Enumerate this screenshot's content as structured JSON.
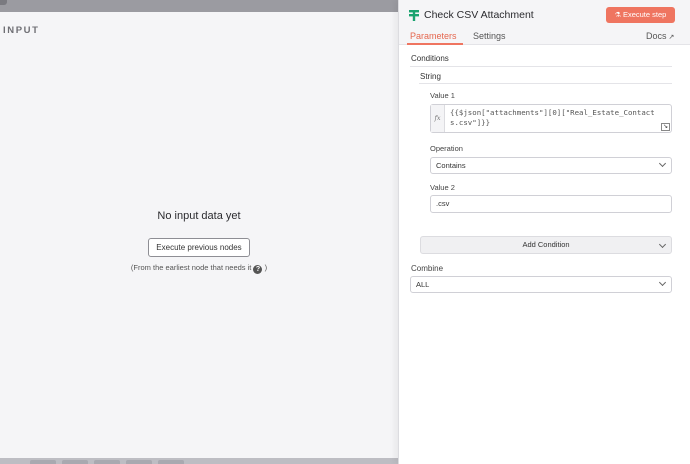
{
  "input_pane": {
    "label": "INPUT",
    "empty_title": "No input data yet",
    "execute_previous_label": "Execute previous nodes",
    "hint_text": "(From the earliest node that needs it",
    "hint_close": ")"
  },
  "node": {
    "title": "Check CSV Attachment",
    "execute_label": "Execute step",
    "icon": "node-branch-icon",
    "icon_color": "#1aa36f",
    "accent_color": "#ef7560"
  },
  "tabs": {
    "parameters": "Parameters",
    "settings": "Settings",
    "docs": "Docs"
  },
  "params": {
    "conditions_label": "Conditions",
    "string_label": "String",
    "value1_label": "Value 1",
    "value1_fx": "fx",
    "value1_expression": "{{$json[\"attachments\"][0][\"Real_Estate_Contacts.csv\"]}}",
    "operation_label": "Operation",
    "operation_value": "Contains",
    "value2_label": "Value 2",
    "value2_value": ".csv",
    "add_condition_label": "Add Condition",
    "combine_label": "Combine",
    "combine_value": "ALL"
  }
}
